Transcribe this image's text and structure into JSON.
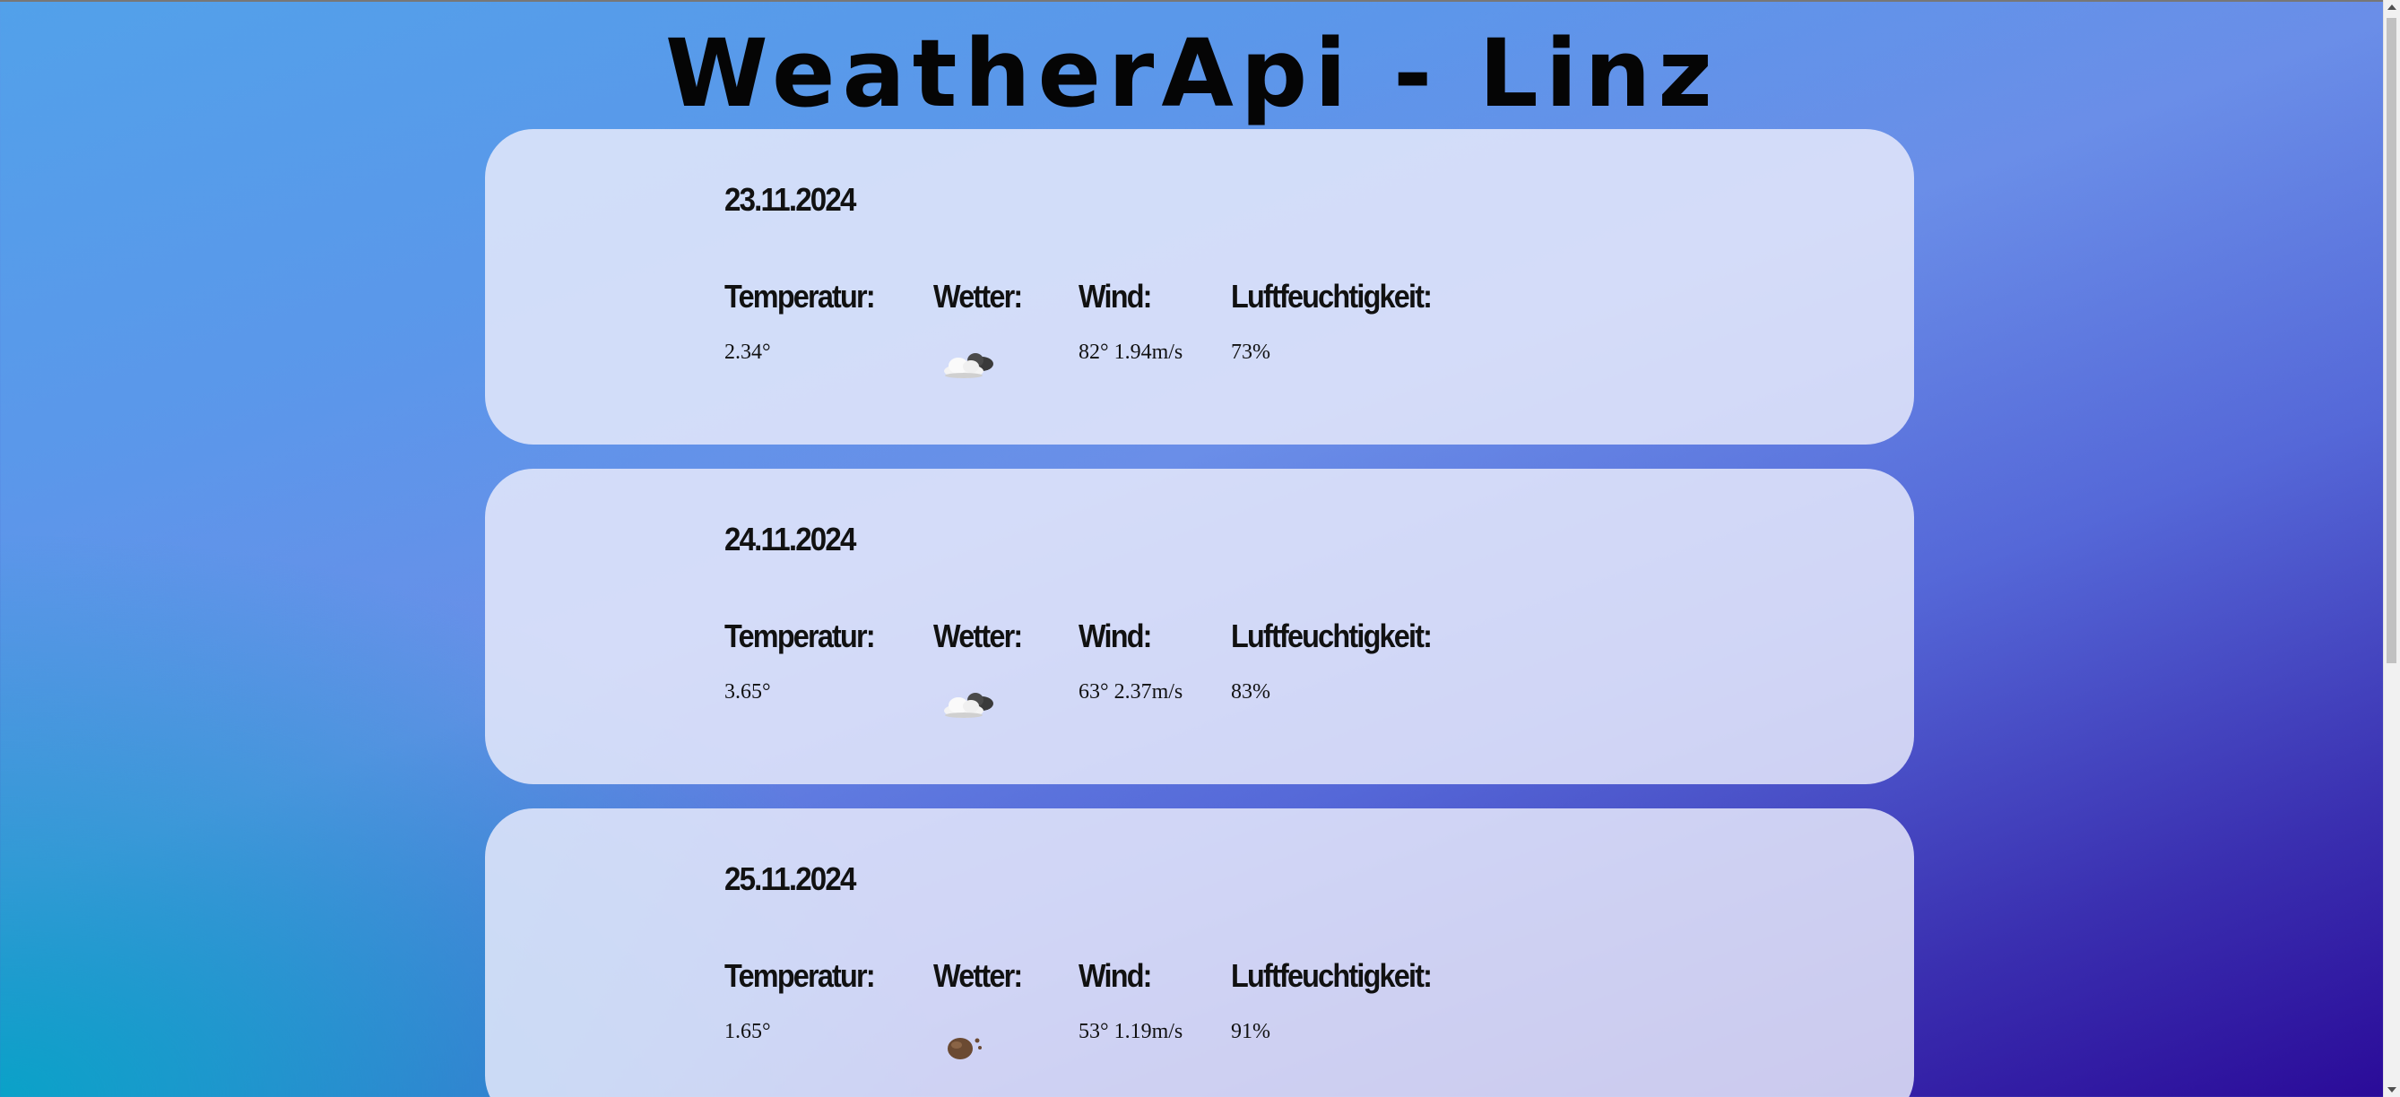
{
  "page": {
    "title": "WeatherApi - Linz"
  },
  "forecast": [
    {
      "date": "23.11.2024",
      "labels": {
        "temp": "Temperatur:",
        "weather": "Wetter:",
        "wind": "Wind:",
        "humidity": "Luftfeuchtigkeit:"
      },
      "temp": "2.34°",
      "weather_icon": "partly-cloudy-icon",
      "wind": "82° 1.94m/s",
      "humidity": "73%"
    },
    {
      "date": "24.11.2024",
      "labels": {
        "temp": "Temperatur:",
        "weather": "Wetter:",
        "wind": "Wind:",
        "humidity": "Luftfeuchtigkeit:"
      },
      "temp": "3.65°",
      "weather_icon": "partly-cloudy-icon",
      "wind": "63° 2.37m/s",
      "humidity": "83%"
    },
    {
      "date": "25.11.2024",
      "labels": {
        "temp": "Temperatur:",
        "weather": "Wetter:",
        "wind": "Wind:",
        "humidity": "Luftfeuchtigkeit:"
      },
      "temp": "1.65°",
      "weather_icon": "brown-blob-icon",
      "wind": "53° 1.19m/s",
      "humidity": "91%"
    }
  ],
  "colors": {
    "title": "#050505",
    "card_background": "#e8ebfc",
    "gradient_start": "#0aa2c8",
    "gradient_end": "#2a0a98"
  }
}
